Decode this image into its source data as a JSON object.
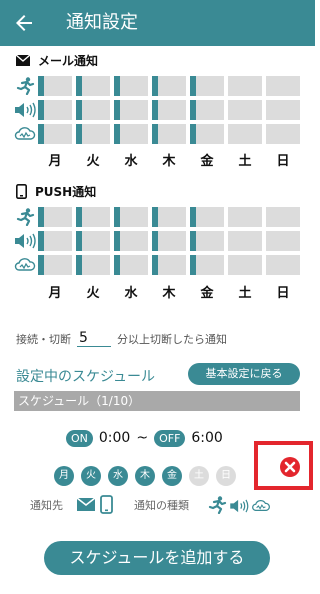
{
  "header": {
    "title": "通知設定"
  },
  "days": [
    "月",
    "火",
    "水",
    "木",
    "金",
    "土",
    "日"
  ],
  "mail_section": {
    "title": "メール通知",
    "rows": [
      {
        "category": "activity",
        "enabled": [
          true,
          true,
          true,
          true,
          true,
          false,
          false
        ]
      },
      {
        "category": "sound",
        "enabled": [
          true,
          true,
          true,
          true,
          true,
          false,
          false
        ]
      },
      {
        "category": "connection",
        "enabled": [
          true,
          true,
          true,
          true,
          true,
          false,
          false
        ]
      }
    ]
  },
  "push_section": {
    "title": "PUSH通知",
    "rows": [
      {
        "category": "activity",
        "enabled": [
          true,
          true,
          true,
          true,
          true,
          false,
          false
        ]
      },
      {
        "category": "sound",
        "enabled": [
          true,
          true,
          true,
          true,
          true,
          false,
          false
        ]
      },
      {
        "category": "connection",
        "enabled": [
          true,
          true,
          true,
          true,
          true,
          false,
          false
        ]
      }
    ]
  },
  "disconnect": {
    "label": "接続・切断",
    "minutes": "5",
    "suffix": "分以上切断したら通知"
  },
  "schedule": {
    "section_label": "設定中のスケジュール",
    "reset_button": "基本設定に戻る",
    "header": "スケジュール（1/10）",
    "on_label": "ON",
    "on_time": "0:00",
    "tilde": "~",
    "off_label": "OFF",
    "off_time": "6:00",
    "days_active": [
      true,
      true,
      true,
      true,
      true,
      false,
      false
    ],
    "destination_label": "通知先",
    "type_label": "通知の種類"
  },
  "add_button": "スケジュールを追加する",
  "colors": {
    "accent": "#3a8a94",
    "disabled": "#dcdcdc",
    "delete": "#e3262d"
  }
}
